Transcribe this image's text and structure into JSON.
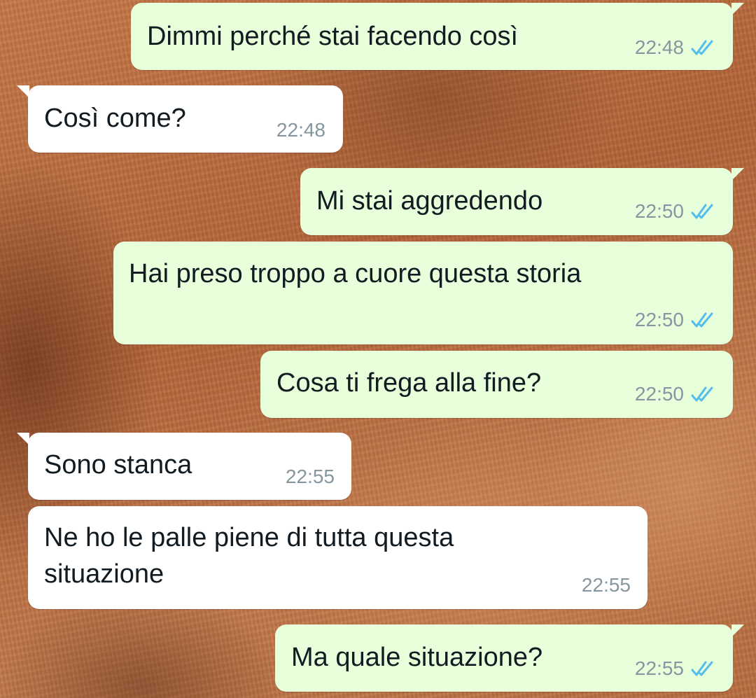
{
  "conversation": {
    "messages": [
      {
        "direction": "out",
        "text": "Dimmi perché stai facendo così",
        "time": "22:48",
        "status": "read"
      },
      {
        "direction": "in",
        "text": "Così come?",
        "time": "22:48"
      },
      {
        "direction": "out",
        "text": "Mi stai aggredendo",
        "time": "22:50",
        "status": "read"
      },
      {
        "direction": "out",
        "text": "Hai preso troppo a cuore questa storia",
        "time": "22:50",
        "status": "read"
      },
      {
        "direction": "out",
        "text": "Cosa ti frega alla fine?",
        "time": "22:50",
        "status": "read"
      },
      {
        "direction": "in",
        "text": "Sono stanca",
        "time": "22:55"
      },
      {
        "direction": "in",
        "text_line1": "Ne ho le palle piene di tutta questa",
        "text_line2": "situazione",
        "time": "22:55"
      },
      {
        "direction": "out",
        "text": "Ma quale situazione?",
        "time": "22:55",
        "status": "read"
      }
    ]
  },
  "colors": {
    "outgoing_bubble": "#e7ffdb",
    "incoming_bubble": "#ffffff",
    "timestamp": "#8696a0",
    "read_ticks": "#53bdeb",
    "wallpaper": "#b5683c"
  },
  "icons": {
    "read_receipt": "double-check-icon"
  }
}
